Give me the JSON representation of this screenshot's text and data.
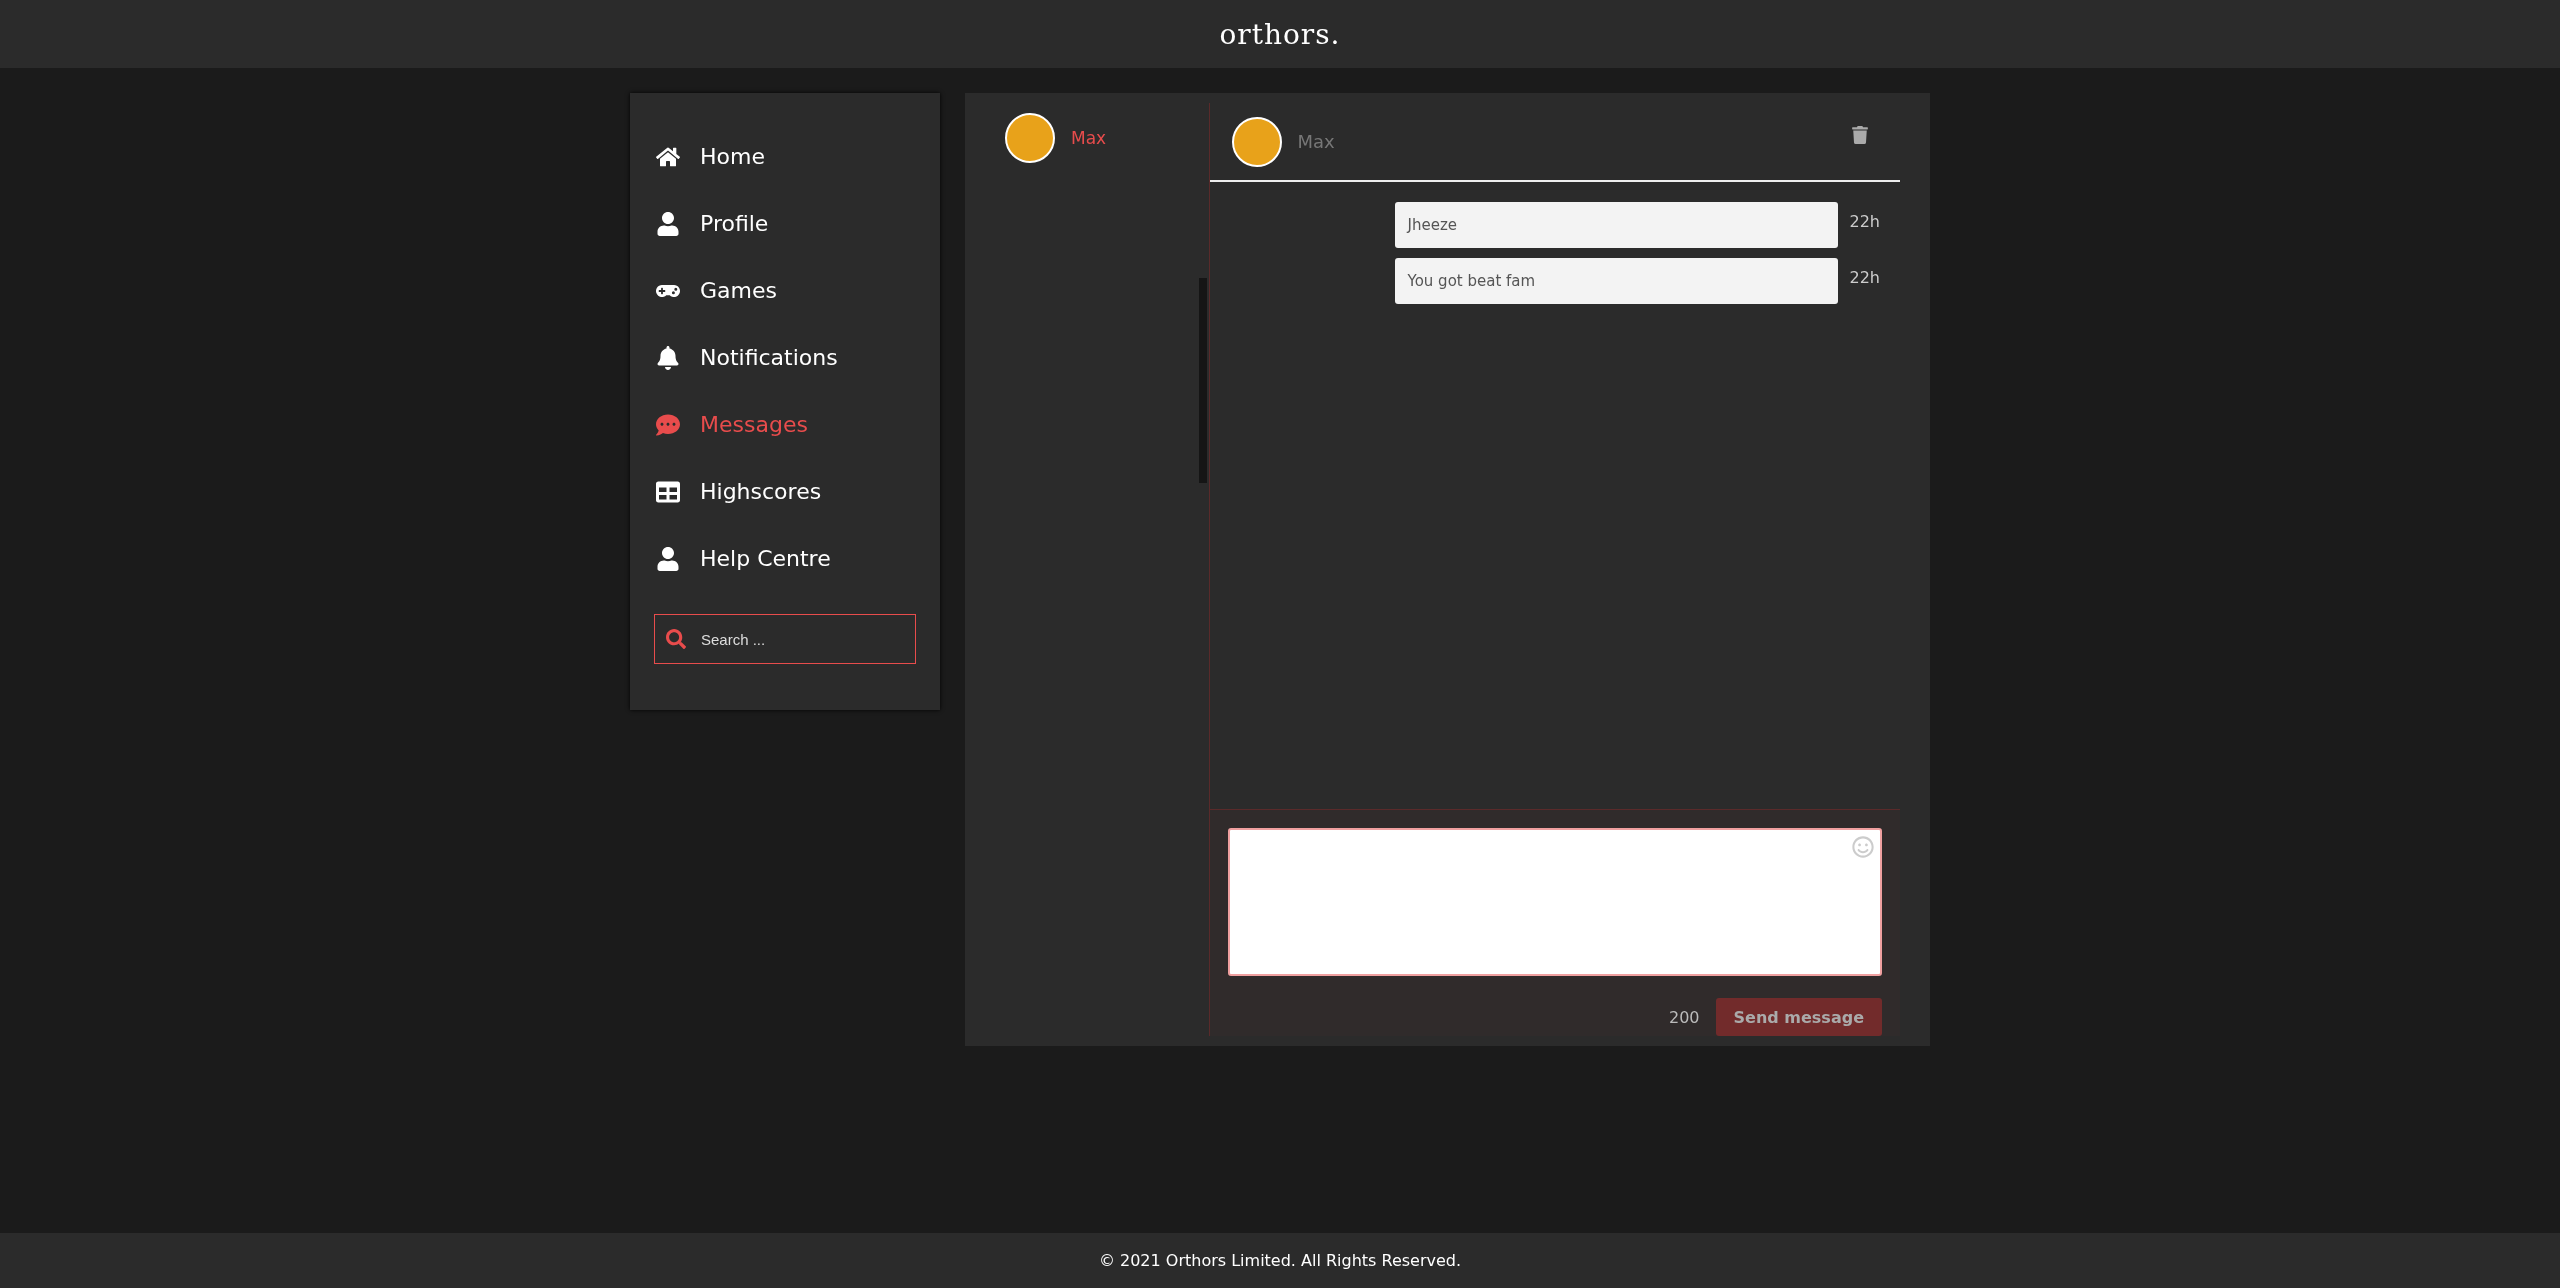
{
  "header": {
    "logo": "orthors."
  },
  "sidebar": {
    "items": [
      {
        "kind": "home",
        "label": "Home",
        "selected": false
      },
      {
        "kind": "profile",
        "label": "Profile",
        "selected": false
      },
      {
        "kind": "games",
        "label": "Games",
        "selected": false
      },
      {
        "kind": "notifications",
        "label": "Notifications",
        "selected": false
      },
      {
        "kind": "messages",
        "label": "Messages",
        "selected": true
      },
      {
        "kind": "highscores",
        "label": "Highscores",
        "selected": false
      },
      {
        "kind": "help",
        "label": "Help Centre",
        "selected": false
      }
    ],
    "search": {
      "placeholder": "Search ..."
    }
  },
  "conversations": [
    {
      "name": "Max",
      "selected": true
    }
  ],
  "chat": {
    "name": "Max",
    "messages": [
      {
        "text": "Jheeze",
        "time": "22h"
      },
      {
        "text": "You got beat fam",
        "time": "22h"
      }
    ],
    "compose": {
      "counter": "200",
      "send_label": "Send message",
      "disabled": true
    }
  },
  "footer": "© 2021 Orthors Limited. All Rights Reserved."
}
